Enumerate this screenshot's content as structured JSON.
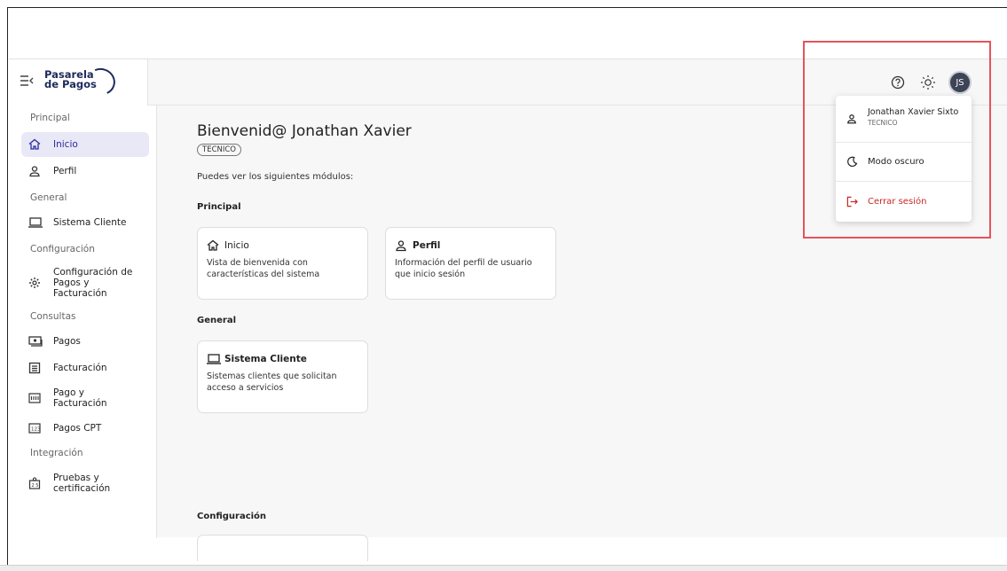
{
  "header": {
    "logo_line1": "Pasarela",
    "logo_line2": "de Pagos",
    "avatar_initials": "JS"
  },
  "sidebar": {
    "sections": [
      {
        "title": "Principal",
        "items": [
          {
            "label": "Inicio",
            "icon": "home-icon",
            "active": true
          },
          {
            "label": "Perfil",
            "icon": "user-icon"
          }
        ]
      },
      {
        "title": "General",
        "items": [
          {
            "label": "Sistema Cliente",
            "icon": "laptop-icon"
          }
        ]
      },
      {
        "title": "Configuración",
        "items": [
          {
            "label": "Configuración de Pagos y Facturación",
            "icon": "gear-icon"
          }
        ]
      },
      {
        "title": "Consultas",
        "items": [
          {
            "label": "Pagos",
            "icon": "money-icon"
          },
          {
            "label": "Facturación",
            "icon": "receipt-icon"
          },
          {
            "label": "Pago y Facturación",
            "icon": "numbers-icon"
          },
          {
            "label": "Pagos CPT",
            "icon": "numbers-123-icon"
          }
        ]
      },
      {
        "title": "Integración",
        "items": [
          {
            "label": "Pruebas y certificación",
            "icon": "certificate-icon"
          }
        ]
      }
    ]
  },
  "main": {
    "welcome": "Bienvenid@ Jonathan Xavier",
    "role": "TECNICO",
    "intro": "Puedes ver los siguientes módulos:",
    "groups": [
      {
        "title": "Principal",
        "cards": [
          {
            "title": "Inicio",
            "desc": "Vista de bienvenida con características del sistema"
          },
          {
            "title": "Perfil",
            "desc": "Información del perfil de usuario que inicio sesión"
          }
        ]
      },
      {
        "title": "General",
        "cards": [
          {
            "title": "Sistema Cliente",
            "desc": "Sistemas clientes que solicitan acceso a servicios"
          }
        ]
      },
      {
        "title": "Configuración",
        "cards": []
      }
    ]
  },
  "user_menu": {
    "name": "Jonathan Xavier Sixto",
    "role": "TECNICO",
    "dark_mode_label": "Modo oscuro",
    "logout_label": "Cerrar sesión"
  },
  "colors": {
    "accent": "#2b2b9e",
    "active_bg": "#e9e8f7",
    "logo": "#1d2a5c",
    "danger": "#c62828",
    "highlight": "#e5545b"
  }
}
